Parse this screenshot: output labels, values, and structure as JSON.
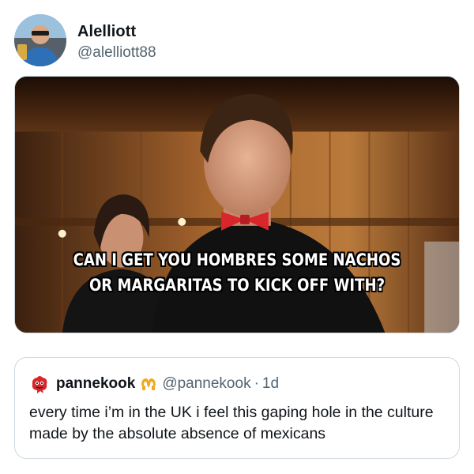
{
  "tweet": {
    "display_name": "Alelliott",
    "handle": "@alelliott88",
    "avatar_icon": "profile-photo"
  },
  "media": {
    "caption_line1": "CAN I GET YOU HOMBRES SOME NACHOS",
    "caption_line2": "OR MARGARITAS TO KICK OFF WITH?"
  },
  "quoted_tweet": {
    "avatar_icon": "red-creature-avatar-icon",
    "display_name": "pannekook",
    "badge_icon": "heart-hands-icon",
    "handle": "@pannekook",
    "separator": "·",
    "time": "1d",
    "text": "every time i’m in the UK i feel this gaping hole in the culture made by the absolute absence of mexicans"
  },
  "colors": {
    "text_primary": "#0f1419",
    "text_secondary": "#536471",
    "border": "#cfd9de",
    "bow_tie": "#d8262b",
    "badge": "#f2a81d"
  }
}
